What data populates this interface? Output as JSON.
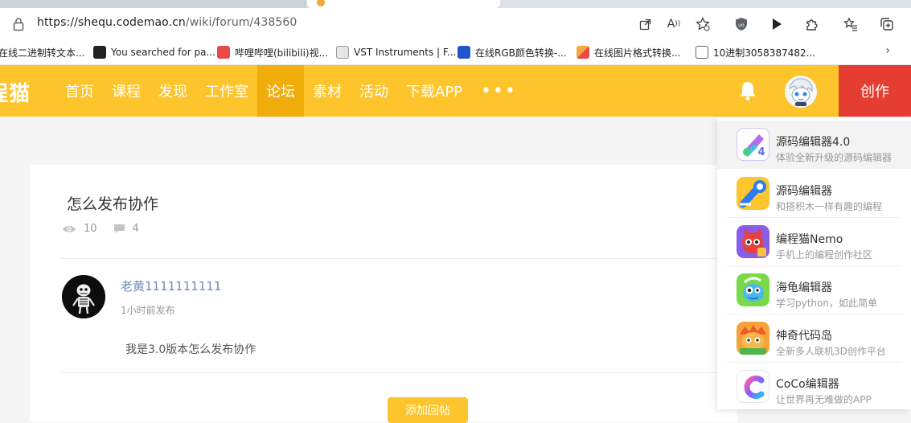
{
  "browser": {
    "url_host": "https://shequ.codemao.cn",
    "url_path": "/wiki/forum/438560",
    "bookmarks": [
      {
        "label": "在线二进制转文本...",
        "color": "#ffffff"
      },
      {
        "label": "You searched for pa...",
        "color": "#222222"
      },
      {
        "label": "哔哩哔哩(bilibili)视...",
        "color": "#e84a4a"
      },
      {
        "label": "VST Instruments | F...",
        "color": "#999999"
      },
      {
        "label": "在线RGB颜色转换-...",
        "color": "#2255cc"
      },
      {
        "label": "在线图片格式转换...",
        "color": "#f6a93b"
      },
      {
        "label": "10进制3058387482...",
        "color": "#ffffff"
      }
    ]
  },
  "site": {
    "logo_text": "程猫",
    "nav": [
      {
        "label": "首页",
        "active": false
      },
      {
        "label": "课程",
        "active": false
      },
      {
        "label": "发现",
        "active": false
      },
      {
        "label": "工作室",
        "active": false
      },
      {
        "label": "论坛",
        "active": true
      },
      {
        "label": "素材",
        "active": false
      },
      {
        "label": "活动",
        "active": false
      },
      {
        "label": "下载APP",
        "active": false
      }
    ],
    "nav_more": "•••",
    "create_label": "创作",
    "brand_color": "#fec42b",
    "create_color": "#e63d32"
  },
  "post": {
    "title": "怎么发布协作",
    "views": "10",
    "comments": "4",
    "author": "老黄1111111111",
    "time": "1小时前发布",
    "body": "我是3.0版本怎么发布协作",
    "reply_label": "添加回帖"
  },
  "dropdown": {
    "items": [
      {
        "name": "源码编辑器4.0",
        "desc": "体验全新升级的源码编辑器",
        "icon": "kitten4-icon"
      },
      {
        "name": "源码编辑器",
        "desc": "和搭积木一样有趣的编程",
        "icon": "kitten-icon"
      },
      {
        "name": "编程猫Nemo",
        "desc": "手机上的编程创作社区",
        "icon": "nemo-icon"
      },
      {
        "name": "海龟编辑器",
        "desc": "学习python，如此简单",
        "icon": "turtle-icon"
      },
      {
        "name": "神奇代码岛",
        "desc": "全新多人联机3D创作平台",
        "icon": "code-island-icon"
      },
      {
        "name": "CoCo编辑器",
        "desc": "让世界再无难做的APP",
        "icon": "coco-icon"
      }
    ]
  }
}
